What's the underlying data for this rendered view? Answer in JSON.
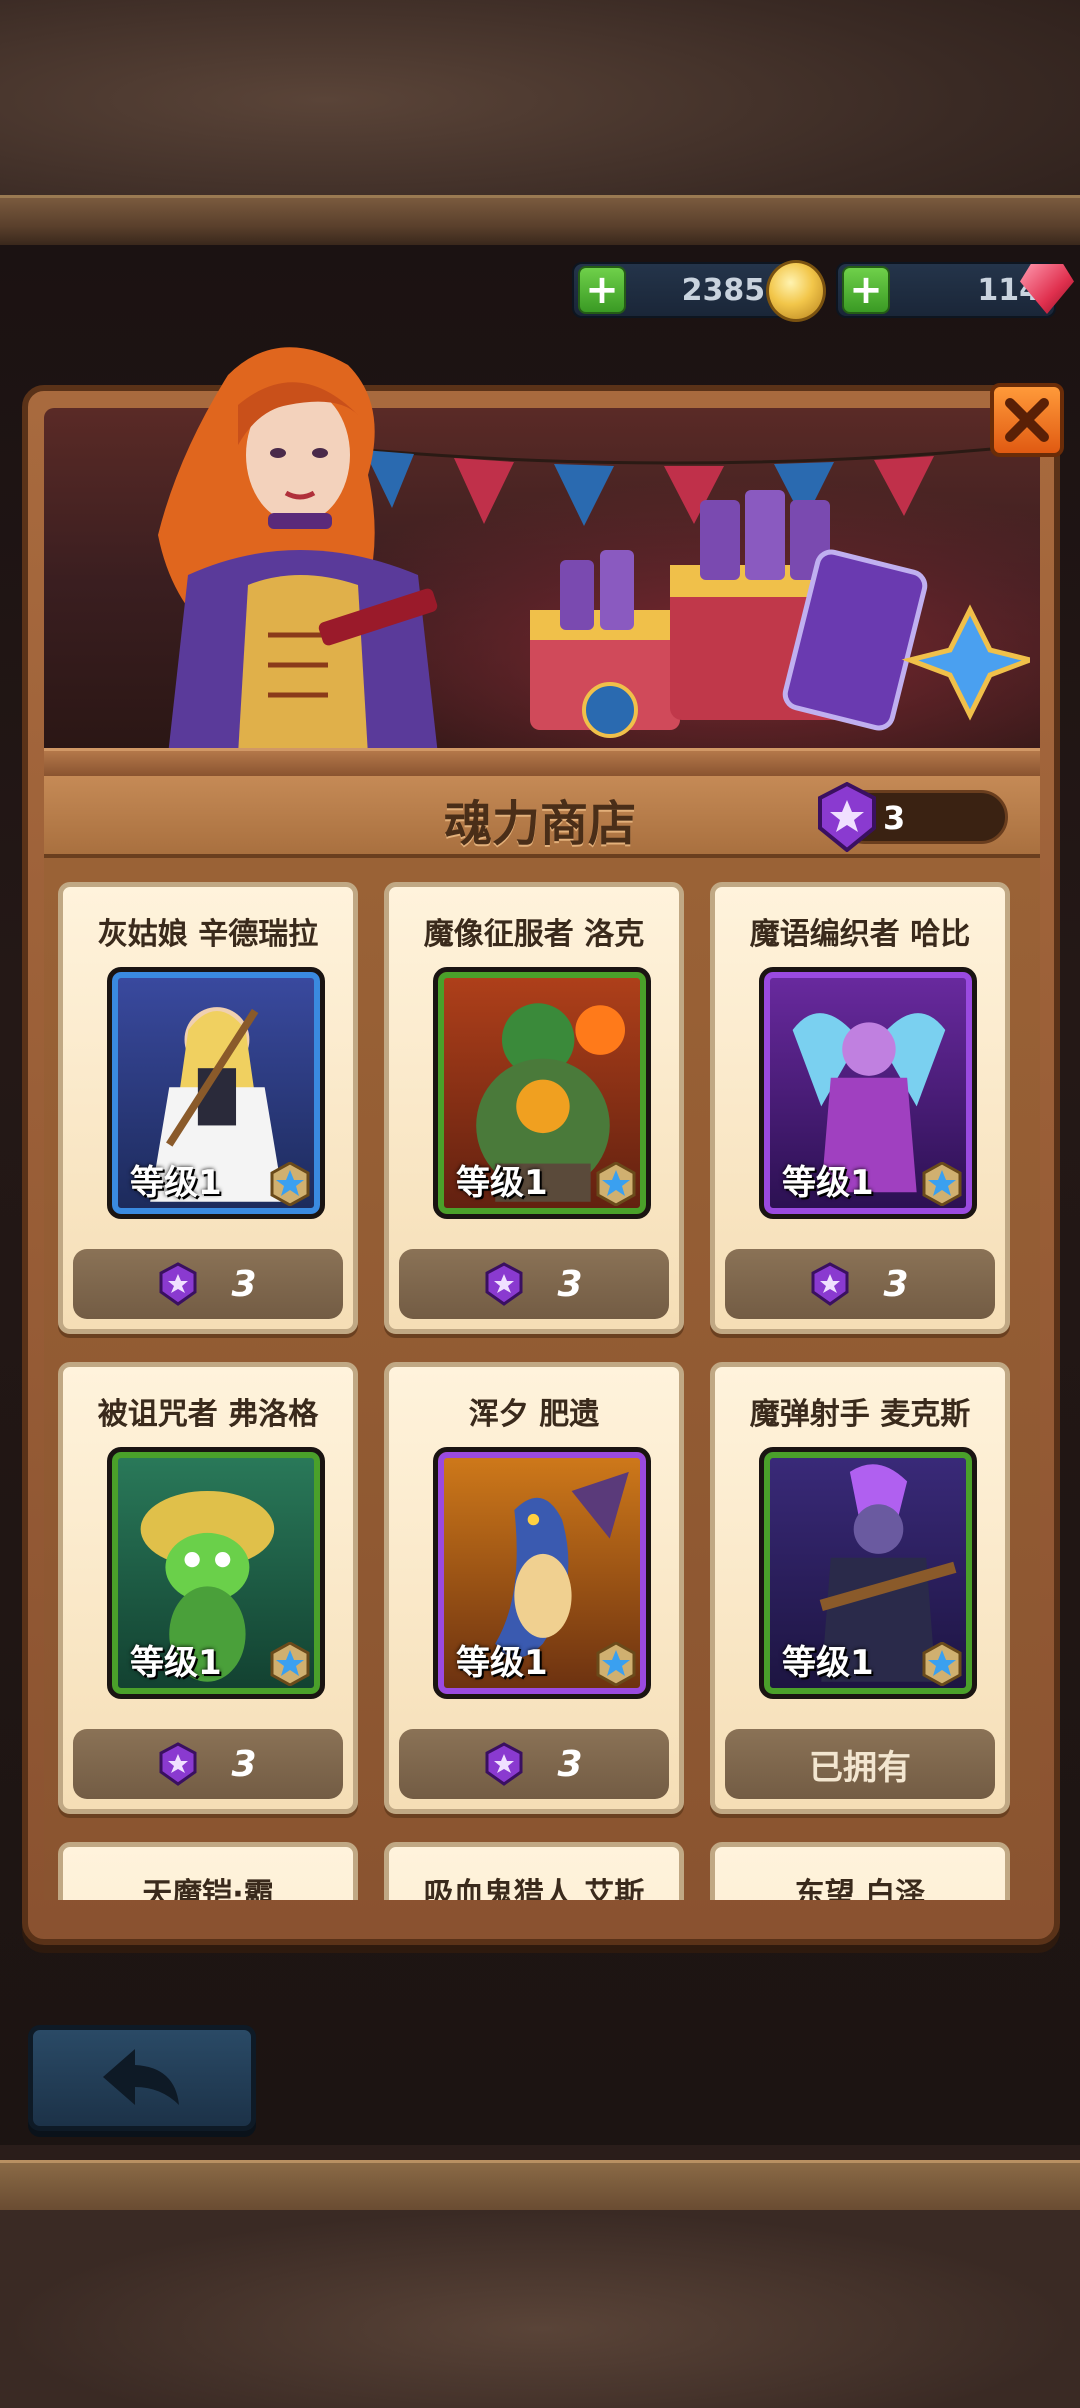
{
  "currency": {
    "gold": "23850",
    "gems": "114",
    "gold_icon": "gold-coin-icon",
    "gem_icon": "red-gem-icon"
  },
  "shop": {
    "title": "魂力商店",
    "soul_count": "3",
    "soul_icon": "purple-soul-gem-icon"
  },
  "buttons": {
    "close_icon": "close-icon",
    "back_icon": "back-arrow-icon"
  },
  "cards": [
    {
      "name": "灰姑娘 辛德瑞拉",
      "level": "等级1",
      "price": "3",
      "owned": false,
      "frame": "blue"
    },
    {
      "name": "魔像征服者 洛克",
      "level": "等级1",
      "price": "3",
      "owned": false,
      "frame": "green"
    },
    {
      "name": "魔语编织者 哈比",
      "level": "等级1",
      "price": "3",
      "owned": false,
      "frame": "purple"
    },
    {
      "name": "被诅咒者 弗洛格",
      "level": "等级1",
      "price": "3",
      "owned": false,
      "frame": "green"
    },
    {
      "name": "浑夕 肥遗",
      "level": "等级1",
      "price": "3",
      "owned": false,
      "frame": "purple"
    },
    {
      "name": "魔弹射手 麦克斯",
      "level": "等级1",
      "price": "已拥有",
      "owned": true,
      "frame": "green"
    },
    {
      "name": "天魔铠·霸",
      "level": "",
      "price": "",
      "owned": false,
      "frame": ""
    },
    {
      "name": "吸血鬼猎人 艾斯",
      "level": "",
      "price": "",
      "owned": false,
      "frame": ""
    },
    {
      "name": "东望 白泽",
      "level": "",
      "price": "",
      "owned": false,
      "frame": ""
    }
  ],
  "colors": {
    "panel": "#a86a3e",
    "card_bg": "#fff3dc",
    "price_bg": "#8a7256",
    "close_btn": "#ff9a3a",
    "back_btn": "#2a4a66"
  }
}
